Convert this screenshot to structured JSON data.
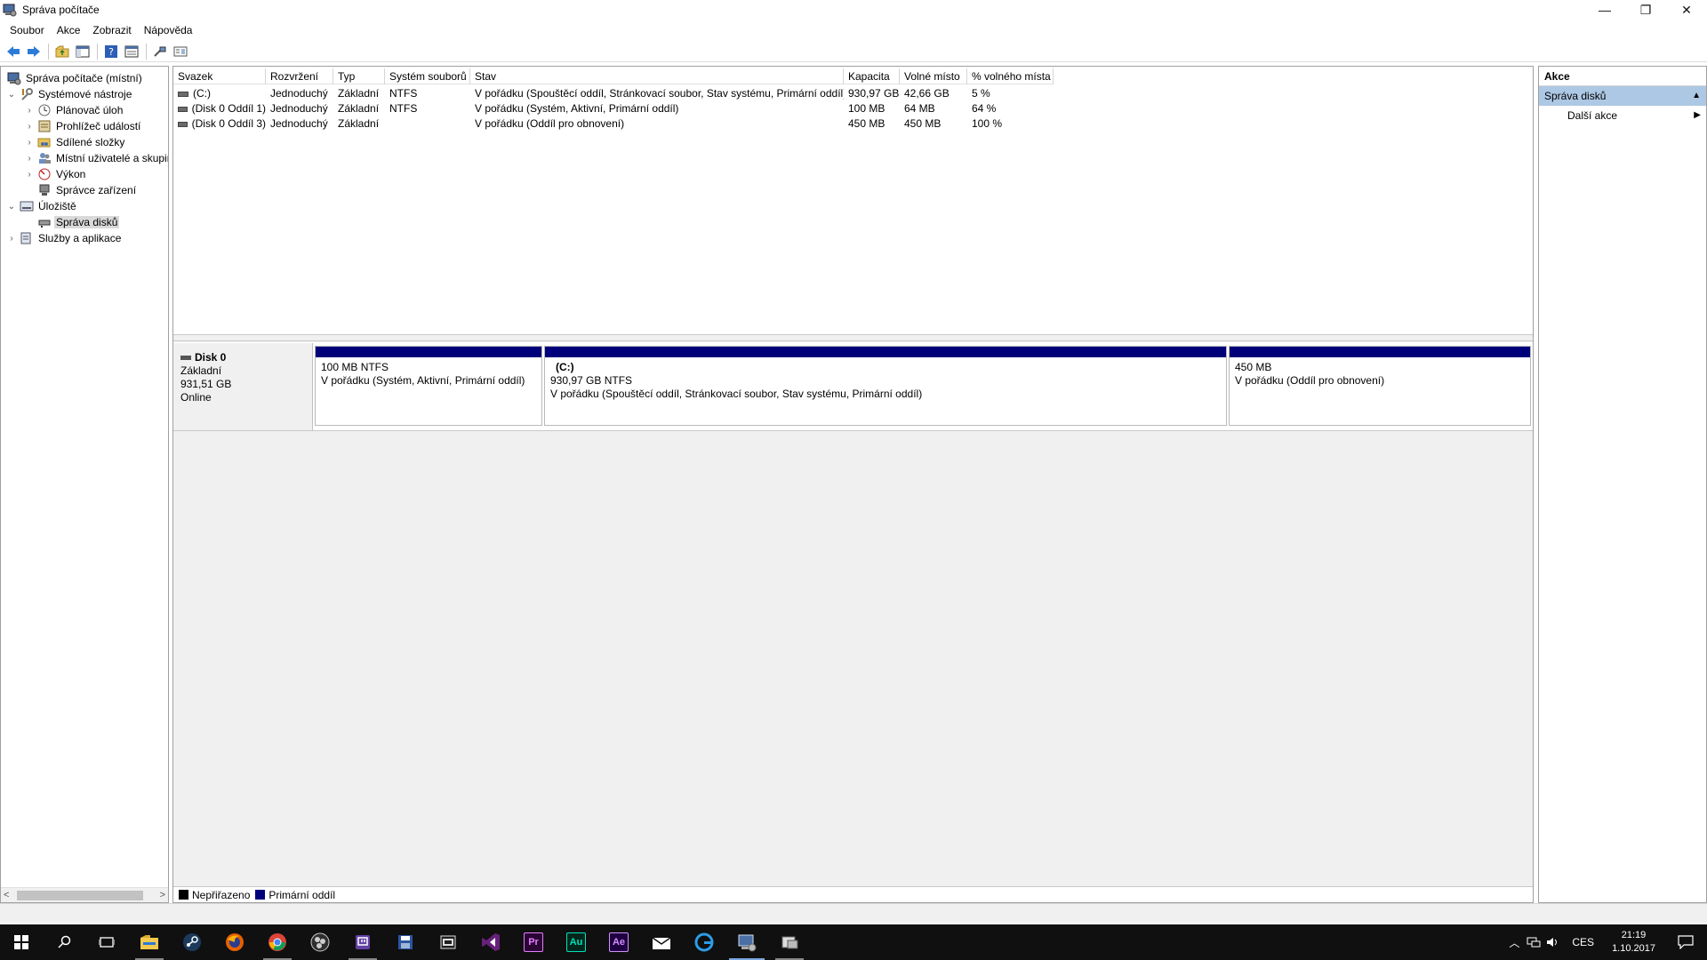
{
  "window": {
    "title": "Správa počítače",
    "controls": {
      "minimize": "—",
      "restore": "❐",
      "close": "✕"
    }
  },
  "menu": [
    "Soubor",
    "Akce",
    "Zobrazit",
    "Nápověda"
  ],
  "toolbar": {
    "icons": [
      "back-icon",
      "forward-icon",
      "up-folder-icon",
      "show-hide-tree-icon",
      "help-icon",
      "properties-icon",
      "connect-icon",
      "view-icon"
    ]
  },
  "tree": {
    "root": "Správa počítače (místní)",
    "system_tools": "Systémové nástroje",
    "task_scheduler": "Plánovač úloh",
    "event_viewer": "Prohlížeč událostí",
    "shared_folders": "Sdílené složky",
    "local_users": "Místní uživatelé a skupiny",
    "performance": "Výkon",
    "device_manager": "Správce zařízení",
    "storage": "Úložiště",
    "disk_management": "Správa disků",
    "services_apps": "Služby a aplikace",
    "expand_glyph": "›",
    "collapse_glyph": "⌄"
  },
  "volumes": {
    "columns": [
      "Svazek",
      "Rozvržení",
      "Typ",
      "Systém souborů",
      "Stav",
      "Kapacita",
      "Volné místo",
      "% volného místa"
    ],
    "rows": [
      [
        "(C:)",
        "Jednoduchý",
        "Základní",
        "NTFS",
        "V pořádku (Spouštěcí oddíl, Stránkovací soubor, Stav systému, Primární oddíl)",
        "930,97 GB",
        "42,66 GB",
        "5 %"
      ],
      [
        "(Disk 0 Oddíl 1)",
        "Jednoduchý",
        "Základní",
        "NTFS",
        "V pořádku (Systém, Aktivní, Primární oddíl)",
        "100 MB",
        "64 MB",
        "64 %"
      ],
      [
        "(Disk 0 Oddíl 3)",
        "Jednoduchý",
        "Základní",
        "",
        "V pořádku (Oddíl pro obnovení)",
        "450 MB",
        "450 MB",
        "100 %"
      ]
    ]
  },
  "disk": {
    "name": "Disk 0",
    "type": "Základní",
    "size": "931,51 GB",
    "status": "Online",
    "partitions": [
      {
        "name": "",
        "size": "100 MB NTFS",
        "status": "V pořádku (Systém, Aktivní, Primární oddíl)"
      },
      {
        "name": "(C:)",
        "size": "930,97 GB NTFS",
        "status": "V pořádku (Spouštěcí oddíl, Stránkovací soubor, Stav systému, Primární oddíl)"
      },
      {
        "name": "",
        "size": "450 MB",
        "status": "V pořádku (Oddíl pro obnovení)"
      }
    ]
  },
  "legend": {
    "unallocated": "Nepřiřazeno",
    "primary": "Primární oddíl",
    "colors": {
      "unallocated": "#000000",
      "primary": "#00007a"
    }
  },
  "actions": {
    "title": "Akce",
    "section": "Správa disků",
    "more": "Další akce"
  },
  "taskbar": {
    "apps": [
      "start-icon",
      "search-icon",
      "task-view-icon",
      "file-explorer-icon",
      "steam-icon",
      "firefox-icon",
      "chrome-icon",
      "obs-icon",
      "twitch-icon",
      "save-icon",
      "media-icon",
      "visual-studio-icon",
      "premiere-icon",
      "audition-icon",
      "after-effects-icon",
      "mail-icon",
      "edge-icon",
      "computer-management-icon",
      "disk-icon"
    ],
    "premiere": "Pr",
    "audition": "Au",
    "after_effects": "Ae",
    "language": "CES",
    "time": "21:19",
    "date": "1.10.2017"
  }
}
